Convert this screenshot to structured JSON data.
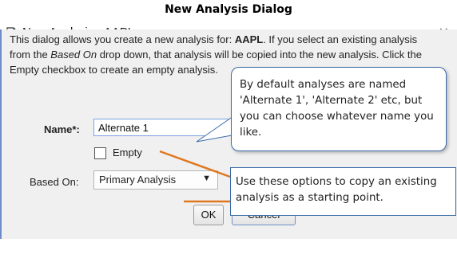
{
  "caption": "New Analysis Dialog",
  "dialog": {
    "title": "New Analysis - AAPL",
    "close_label": "✕",
    "description": {
      "p1": "This dialog allows you create a new analysis for: ",
      "symbol": "AAPL",
      "p2": ". If you select an existing analysis from the ",
      "based_on_em": "Based On",
      "p3": " drop down, that analysis will be copied into the new analysis. Click the Empty checkbox to create an empty analysis."
    },
    "name_label": "Name*:",
    "name_value": "Alternate 1",
    "empty_label": "Empty",
    "empty_checked": false,
    "based_on_label": "Based On:",
    "based_on_value": "Primary Analysis",
    "ok_label": "OK",
    "cancel_label": "Cancel"
  },
  "callouts": {
    "naming": "By default analyses are named 'Alternate 1', 'Alternate 2' etc, but you can choose whatever name you like.",
    "options": "Use these options to copy an existing analysis as a starting point."
  },
  "colors": {
    "callout_border": "#3a6aa8",
    "connector": "#e07820",
    "focus_border": "#7aa3e0"
  }
}
